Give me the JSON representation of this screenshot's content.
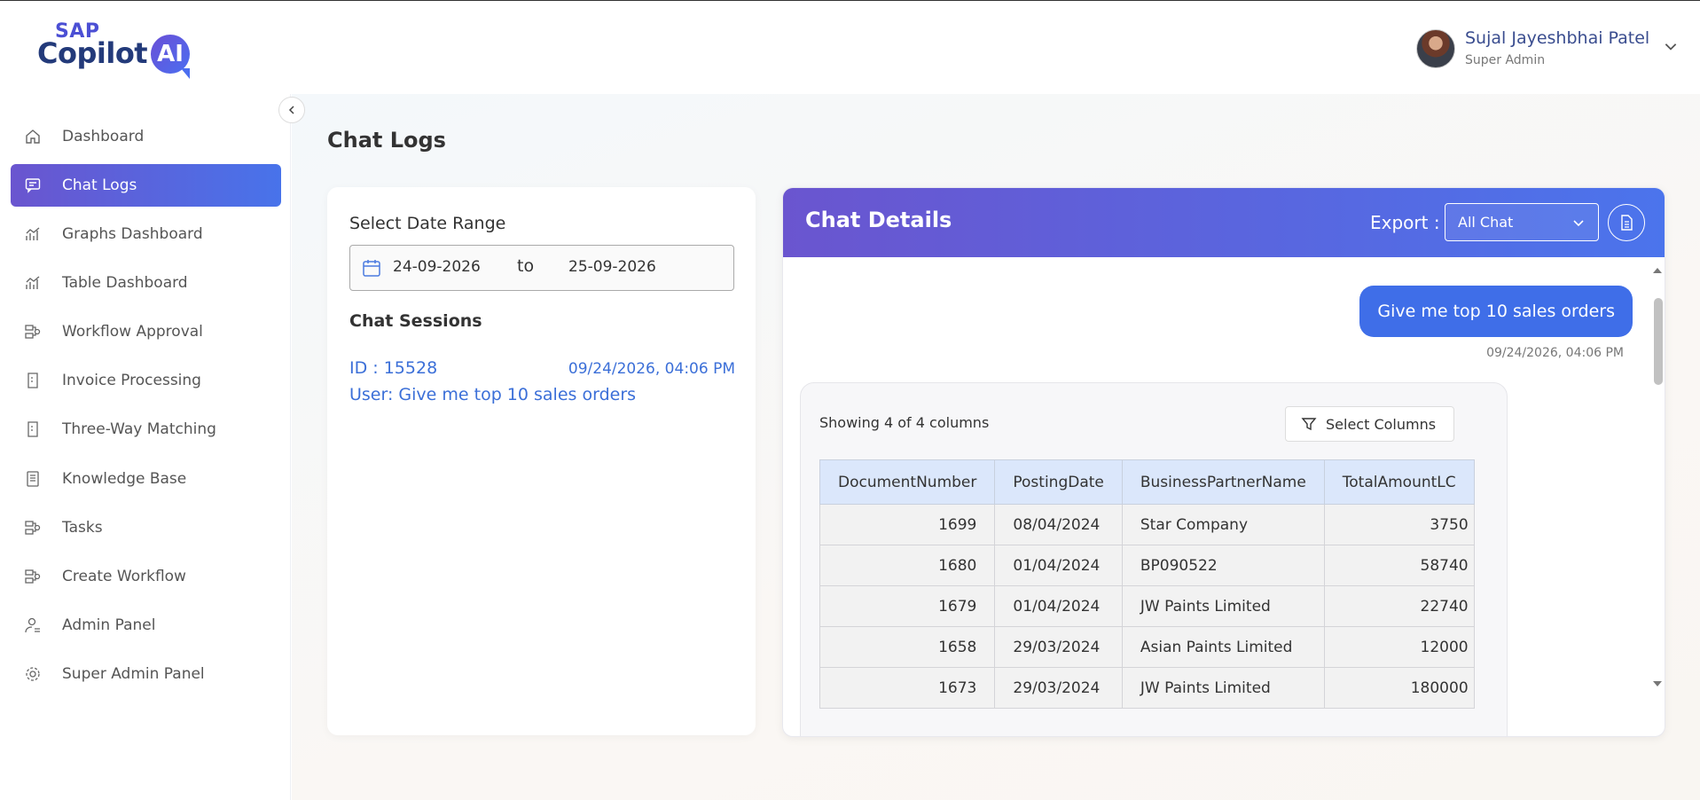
{
  "brand": {
    "top": "SAP",
    "main": "Copilot",
    "badge": "AI"
  },
  "user": {
    "name": "Sujal Jayeshbhai Patel",
    "role": "Super Admin"
  },
  "sidebar": {
    "items": [
      {
        "label": "Dashboard",
        "icon": "home-icon"
      },
      {
        "label": "Chat Logs",
        "icon": "chat-icon",
        "active": true
      },
      {
        "label": "Graphs Dashboard",
        "icon": "chart-icon"
      },
      {
        "label": "Table Dashboard",
        "icon": "chart-icon"
      },
      {
        "label": "Workflow Approval",
        "icon": "workflow-icon"
      },
      {
        "label": "Invoice Processing",
        "icon": "invoice-icon"
      },
      {
        "label": "Three-Way Matching",
        "icon": "invoice-icon"
      },
      {
        "label": "Knowledge Base",
        "icon": "book-icon"
      },
      {
        "label": "Tasks",
        "icon": "workflow-icon"
      },
      {
        "label": "Create Workflow",
        "icon": "workflow-icon"
      },
      {
        "label": "Admin Panel",
        "icon": "user-gear-icon"
      },
      {
        "label": "Super Admin Panel",
        "icon": "gear-icon"
      }
    ]
  },
  "page": {
    "title": "Chat Logs"
  },
  "filters": {
    "date_range_label": "Select Date Range",
    "from": "24-09-2026",
    "to_label": "to",
    "to": "25-09-2026"
  },
  "sessions": {
    "label": "Chat Sessions",
    "items": [
      {
        "id": "ID : 15528",
        "time": "09/24/2026, 04:06 PM",
        "user": "User: Give me top 10 sales orders"
      }
    ]
  },
  "details": {
    "title": "Chat Details",
    "export_label": "Export :",
    "export_value": "All Chat",
    "message": "Give me top 10 sales orders",
    "message_time": "09/24/2026, 04:06 PM",
    "showing": "Showing 4 of 4 columns",
    "select_columns": "Select Columns",
    "columns": [
      "DocumentNumber",
      "PostingDate",
      "BusinessPartnerName",
      "TotalAmountLC"
    ],
    "rows": [
      [
        "1699",
        "08/04/2024",
        "Star Company",
        "3750"
      ],
      [
        "1680",
        "01/04/2024",
        "BP090522",
        "58740"
      ],
      [
        "1679",
        "01/04/2024",
        "JW Paints Limited",
        "22740"
      ],
      [
        "1658",
        "29/03/2024",
        "Asian Paints Limited",
        "12000"
      ],
      [
        "1673",
        "29/03/2024",
        "JW Paints Limited",
        "180000"
      ]
    ]
  },
  "colors": {
    "accent_start": "#6a55cf",
    "accent_end": "#4873ea",
    "link": "#3b6fd8",
    "bubble": "#3f6ee8"
  }
}
